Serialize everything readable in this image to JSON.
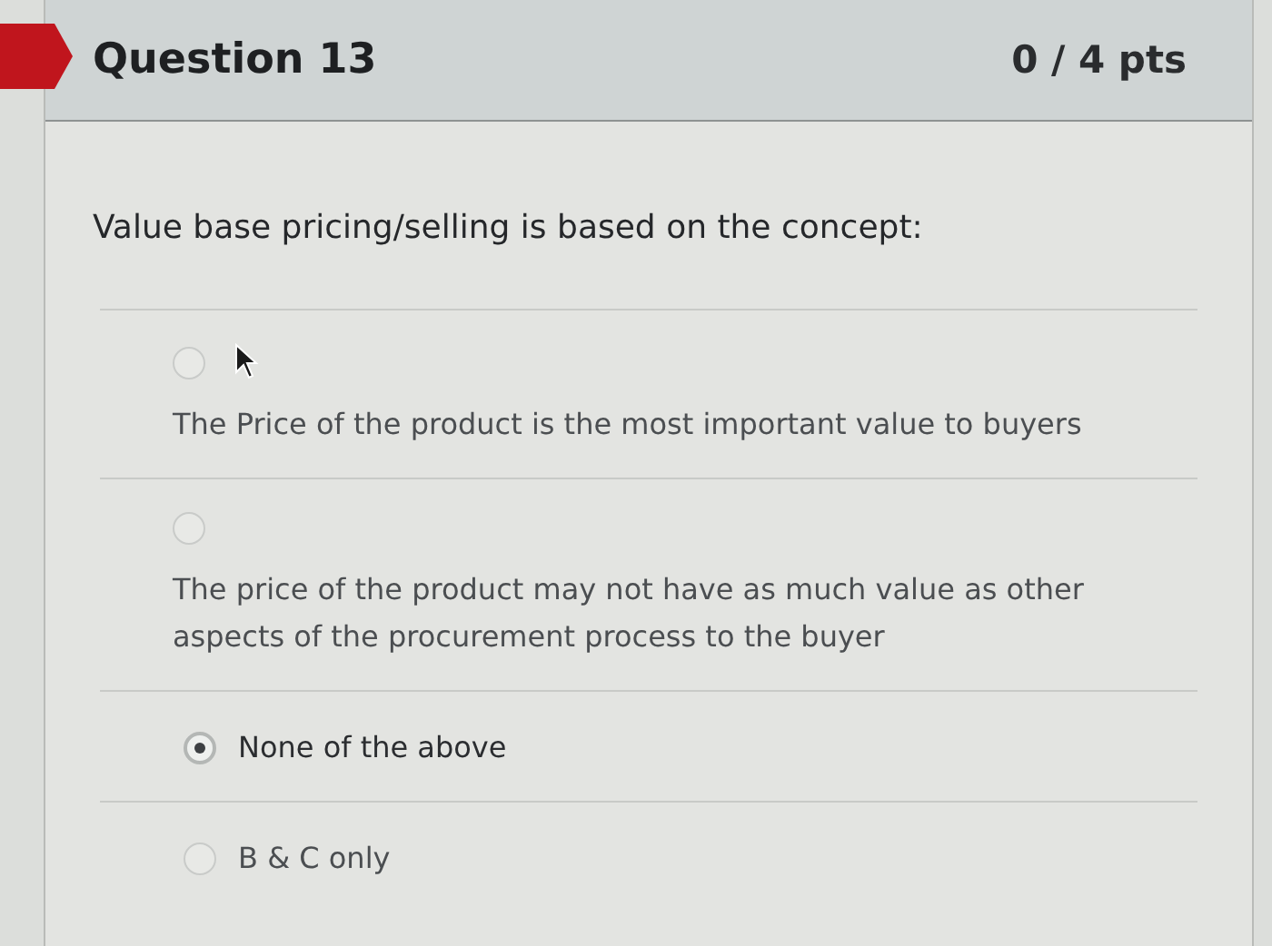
{
  "question": {
    "title": "Question 13",
    "points": "0 / 4 pts",
    "text": "Value base pricing/selling is based on the concept:"
  },
  "answers": [
    {
      "kind": "stacked",
      "label": "The Price of the product is the most important value to buyers",
      "selected": false
    },
    {
      "kind": "stacked",
      "label": "The price of the product may not have as much value as other aspects of the procurement process to the buyer",
      "selected": false
    },
    {
      "kind": "inline",
      "label": "None of the above",
      "selected": true
    },
    {
      "kind": "inline",
      "label": "B & C only",
      "selected": false
    }
  ]
}
